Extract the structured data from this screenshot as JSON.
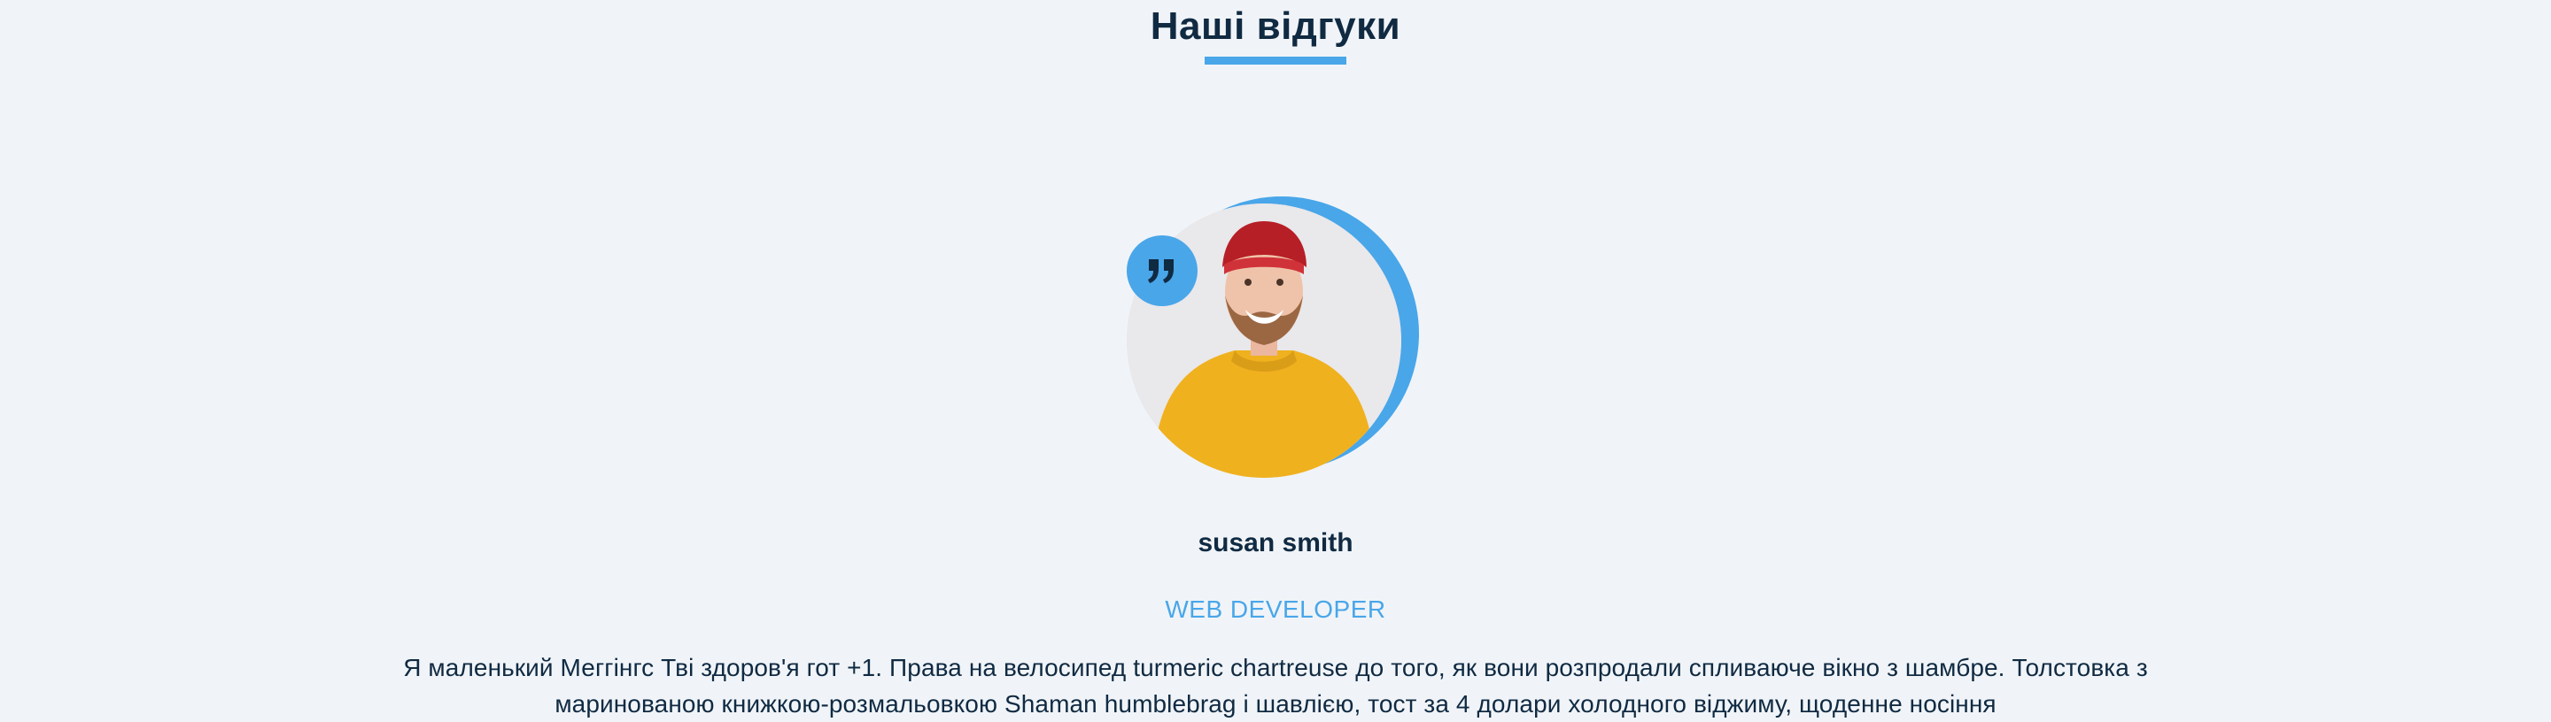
{
  "section": {
    "title": "Наші відгуки"
  },
  "review": {
    "name": "susan smith",
    "job": "web developer",
    "text": "Я маленький Меггінгс Тві здоров'я гот +1. Права на велосипед turmeric chartreuse до того, як вони розпродали спливаюче вікно з шамбре. Толстовка з маринованою книжкою-розмальовкою Shaman humblebrag і шавлією, тост за 4 долари холодного віджиму, щоденне носіння",
    "quote_icon": "quote-right-icon",
    "photo": "person-img"
  },
  "colors": {
    "background": "#f0f4f8",
    "accent": "#49a6e9",
    "text": "#102a42"
  }
}
